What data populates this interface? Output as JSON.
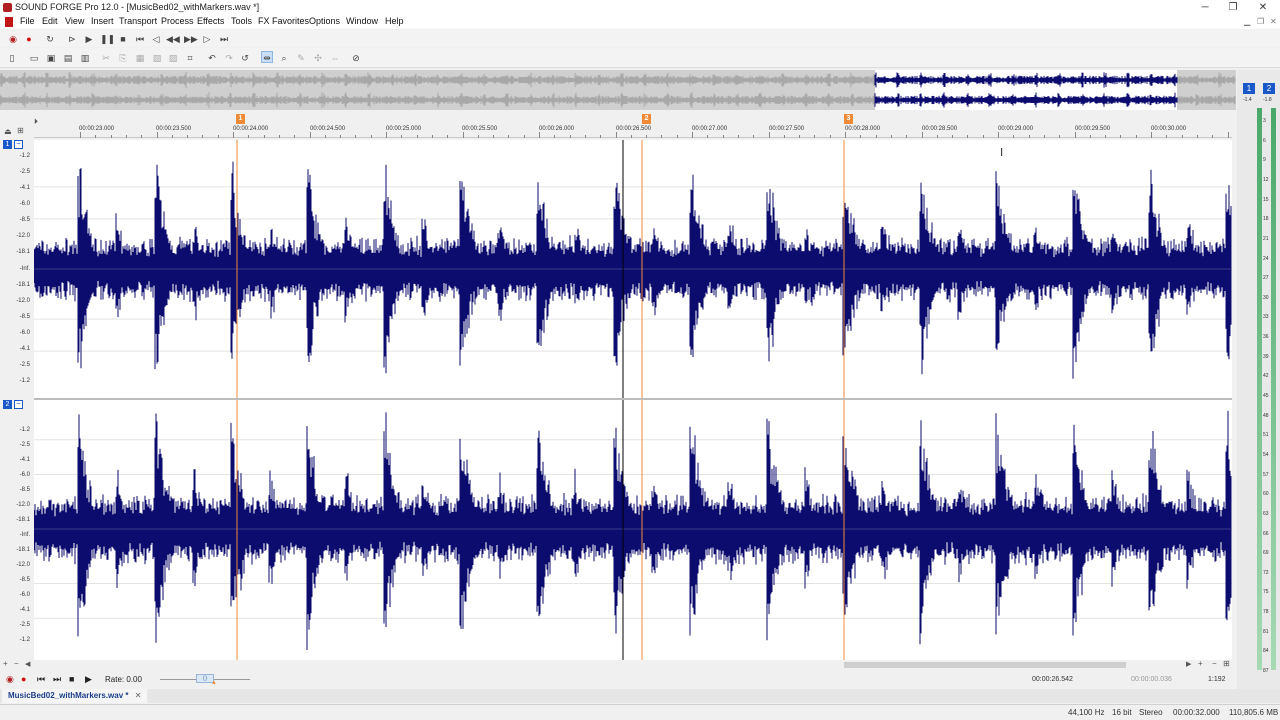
{
  "window": {
    "title": "SOUND FORGE Pro 12.0 - [MusicBed02_withMarkers.wav *]",
    "minimize": "─",
    "restore": "❐",
    "close": "✕"
  },
  "menu": [
    "File",
    "Edit",
    "View",
    "Insert",
    "Transport",
    "Process",
    "Effects",
    "Tools",
    "FX Favorites",
    "Options",
    "Window",
    "Help"
  ],
  "transport_icons": [
    "record-armed-icon",
    "record-icon",
    "loop-icon",
    "play-all-icon",
    "play-icon",
    "pause-icon",
    "stop-icon",
    "go-to-start-icon",
    "rewind-icon",
    "fast-forward-icon",
    "go-to-end-icon"
  ],
  "markers": [
    {
      "label": "1",
      "time": "00:00:23.950"
    },
    {
      "label": "2",
      "time": "00:00:26.350"
    },
    {
      "label": "3",
      "time": "00:00:27.900"
    }
  ],
  "ruler": {
    "labels": [
      "00:00:23.000",
      "00:00:23.500",
      "00:00:24.000",
      "00:00:24.500",
      "00:00:25.000",
      "00:00:25.500",
      "00:00:26.000",
      "00:00:26.500",
      "00:00:27.000",
      "00:00:27.500",
      "00:00:28.000",
      "00:00:28.500",
      "00:00:29.000",
      "00:00:29.500",
      "00:00:30.000"
    ]
  },
  "channels": [
    {
      "id": "1",
      "db_labels": [
        "-1.2",
        "-2.5",
        "-4.1",
        "-6.0",
        "-8.5",
        "-12.0",
        "-18.1",
        "-Inf.",
        "-18.1",
        "-12.0",
        "-8.5",
        "-6.0",
        "-4.1",
        "-2.5",
        "-1.2"
      ]
    },
    {
      "id": "2",
      "db_labels": [
        "-1.2",
        "-2.5",
        "-4.1",
        "-6.0",
        "-8.5",
        "-12.0",
        "-18.1",
        "-Inf.",
        "-18.1",
        "-12.0",
        "-8.5",
        "-6.0",
        "-4.1",
        "-2.5",
        "-1.2"
      ]
    }
  ],
  "meters": {
    "ch1": "1",
    "ch2": "2",
    "peak_left": "-1.4",
    "peak_right": "-1.8",
    "scale": [
      "3",
      "6",
      "9",
      "12",
      "15",
      "18",
      "21",
      "24",
      "27",
      "30",
      "33",
      "36",
      "39",
      "42",
      "45",
      "48",
      "51",
      "54",
      "57",
      "60",
      "63",
      "66",
      "69",
      "72",
      "75",
      "78",
      "81",
      "84",
      "87"
    ]
  },
  "playbar": {
    "rate_label": "Rate: 0.00",
    "cursor_position": "00:00:26.542",
    "selection_length": "00:00:00.036",
    "zoom_ratio": "1:192"
  },
  "document_tab": {
    "name": "MusicBed02_withMarkers.wav *",
    "close": "✕"
  },
  "status": {
    "sample_rate": "44,100 Hz",
    "bit_depth": "16 bit",
    "channels": "Stereo",
    "length": "00:00:32.000",
    "disk_space": "110,805.6 MB"
  },
  "colors": {
    "waveform": "#0c0c6e",
    "marker": "#f08a36",
    "accent": "#1a57c8",
    "meter": "#4aa86a"
  }
}
